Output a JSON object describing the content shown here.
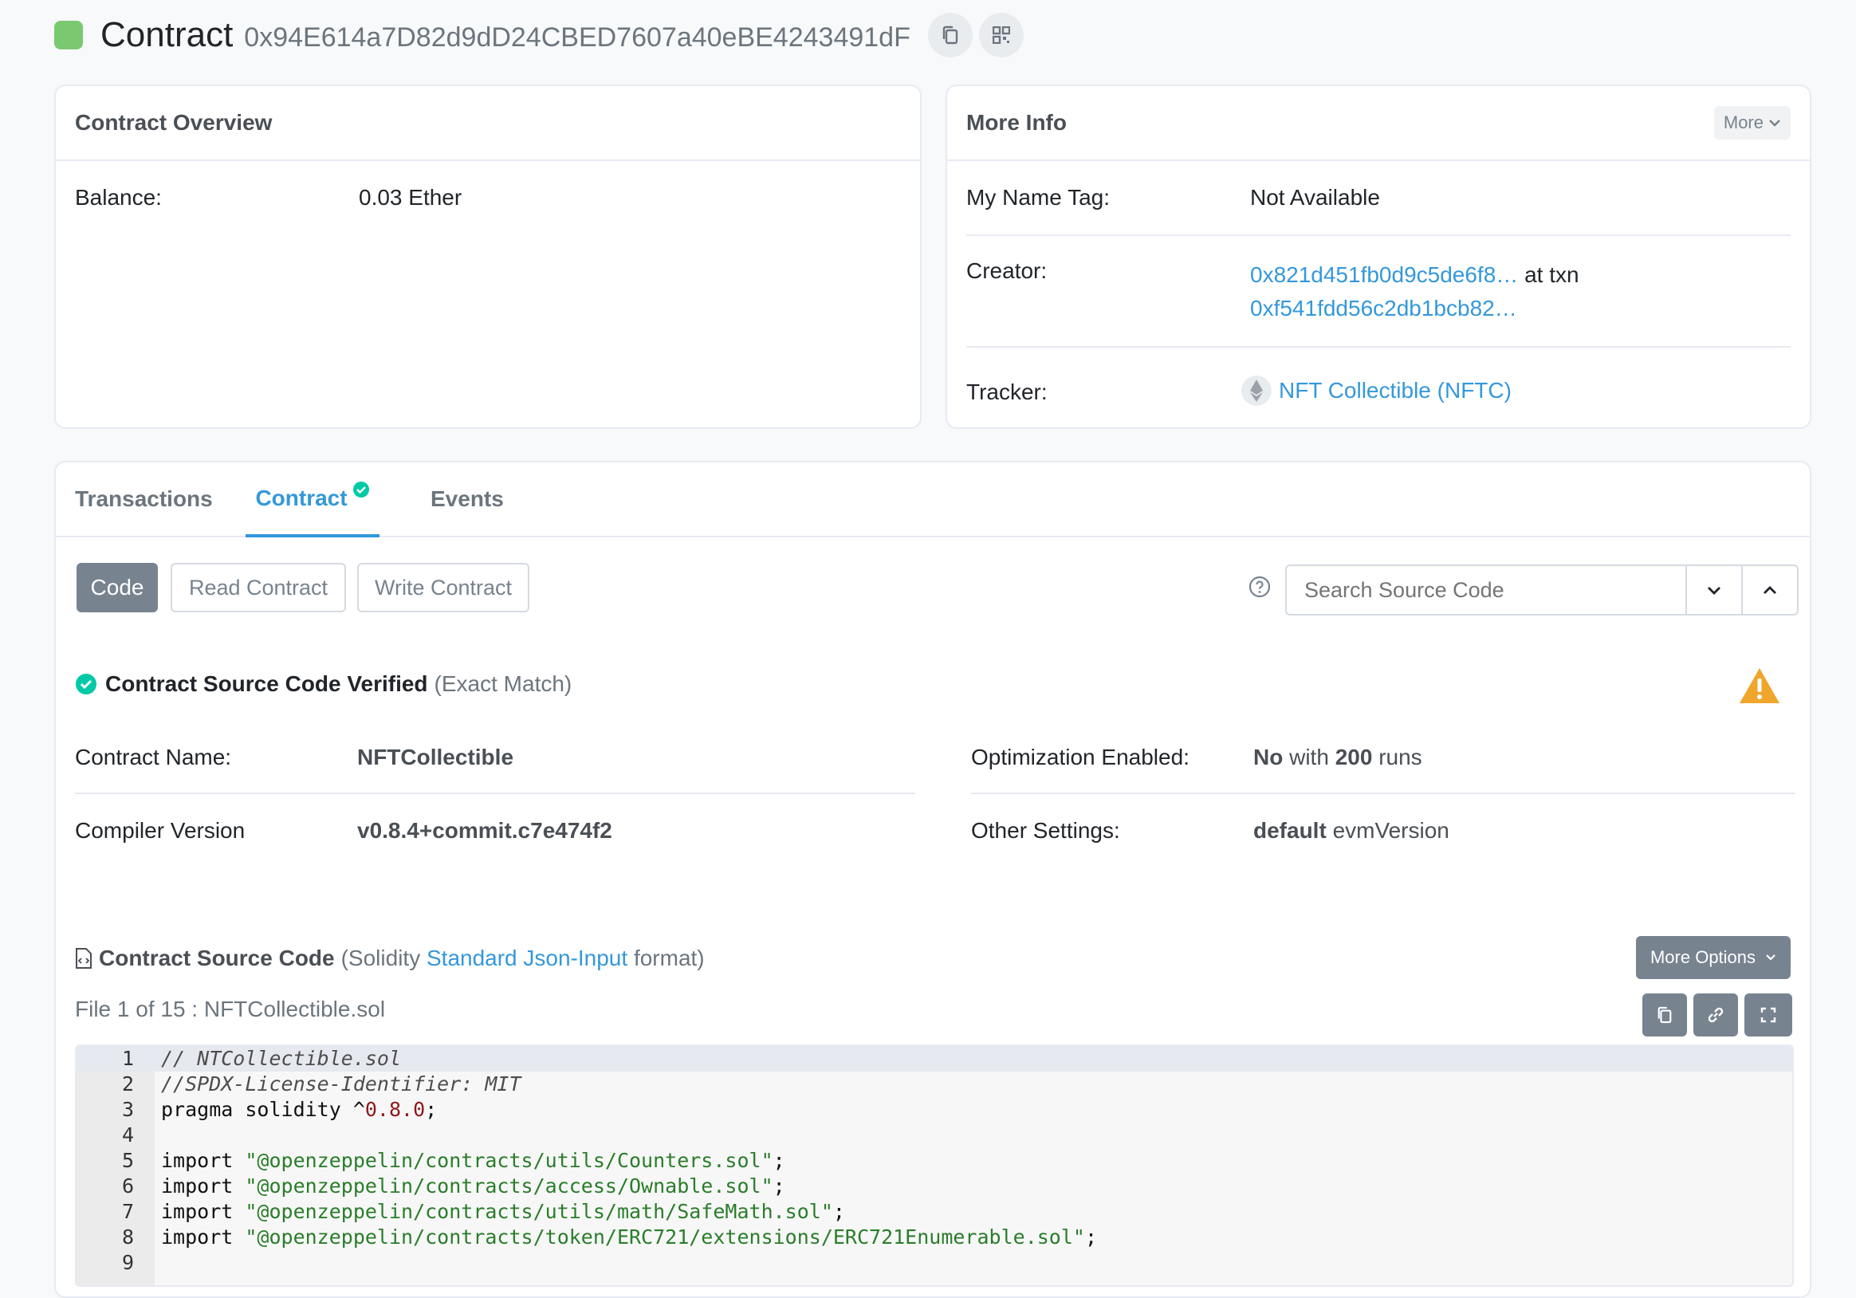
{
  "header": {
    "title": "Contract",
    "address": "0x94E614a7D82d9dD24CBED7607a40eBE4243491dF",
    "icons": [
      "copy-icon",
      "qr-code-icon"
    ]
  },
  "overview": {
    "title": "Contract Overview",
    "balance_label": "Balance:",
    "balance_value": "0.03 Ether"
  },
  "more_info": {
    "title": "More Info",
    "more_button": "More",
    "name_tag_label": "My Name Tag:",
    "name_tag_value": "Not Available",
    "creator_label": "Creator:",
    "creator_address": "0x821d451fb0d9c5de6f8…",
    "creator_at": "at txn",
    "creator_txn": "0xf541fdd56c2db1bcb82…",
    "tracker_label": "Tracker:",
    "tracker_value": "NFT Collectible (NFTC)"
  },
  "tabs": {
    "transactions": "Transactions",
    "contract": "Contract",
    "events": "Events"
  },
  "subtabs": {
    "code": "Code",
    "read": "Read Contract",
    "write": "Write Contract"
  },
  "search": {
    "placeholder": "Search Source Code"
  },
  "verified": {
    "title": "Contract Source Code Verified",
    "note": "(Exact Match)"
  },
  "details": {
    "name_label": "Contract Name:",
    "name_value": "NFTCollectible",
    "compiler_label": "Compiler Version",
    "compiler_value": "v0.8.4+commit.c7e474f2",
    "opt_label": "Optimization Enabled:",
    "opt_value": "No",
    "opt_with": "with",
    "opt_runs": "200",
    "opt_runs_label": "runs",
    "other_label": "Other Settings:",
    "other_value": "default",
    "other_suffix": "evmVersion"
  },
  "source": {
    "title": "Contract Source Code",
    "paren_open": "(Solidity",
    "link": "Standard Json-Input",
    "paren_close": "format)",
    "more_options": "More Options",
    "file": "File 1 of 15 : NFTCollectible.sol"
  },
  "code_lines": [
    {
      "n": "1",
      "t": "// NTCollectible.sol"
    },
    {
      "n": "2",
      "t": "//SPDX-License-Identifier: MIT"
    },
    {
      "n": "3",
      "t": "pragma solidity ^0.8.0;"
    },
    {
      "n": "4",
      "t": ""
    },
    {
      "n": "5",
      "t": "import \"@openzeppelin/contracts/utils/Counters.sol\";"
    },
    {
      "n": "6",
      "t": "import \"@openzeppelin/contracts/access/Ownable.sol\";"
    },
    {
      "n": "7",
      "t": "import \"@openzeppelin/contracts/utils/math/SafeMath.sol\";"
    },
    {
      "n": "8",
      "t": "import \"@openzeppelin/contracts/token/ERC721/extensions/ERC721Enumerable.sol\";"
    },
    {
      "n": "9",
      "t": ""
    }
  ],
  "colors": {
    "link": "#3498db",
    "success": "#00c9a7",
    "warning": "#f0a52b",
    "dark_button": "#77838f"
  }
}
